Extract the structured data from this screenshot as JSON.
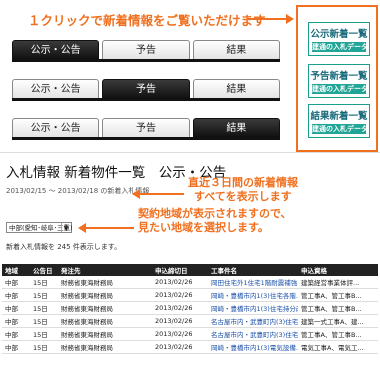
{
  "annotations": {
    "top": "１クリックで新着情報をご覧いただけます",
    "middle": [
      "直近３日間の新着情報",
      "すべてを表示します"
    ],
    "bottom": [
      "契約地域が表示されますので、",
      "見たい地域を選択します。"
    ]
  },
  "tab_rows": [
    {
      "tabs": [
        "公示・公告",
        "予告",
        "結果"
      ],
      "active": 0
    },
    {
      "tabs": [
        "公示・公告",
        "予告",
        "結果"
      ],
      "active": 1
    },
    {
      "tabs": [
        "公示・公告",
        "予告",
        "結果"
      ],
      "active": 2
    }
  ],
  "badges": [
    {
      "title": "公示新着一覧",
      "subtitle": "建通の入札データ"
    },
    {
      "title": "予告新着一覧",
      "subtitle": "建通の入札データ"
    },
    {
      "title": "結果新着一覧",
      "subtitle": "建通の入札データ"
    }
  ],
  "page": {
    "title": "入札情報 新着物件一覧　公示・公告",
    "date_range": "2013/02/15 ～ 2013/02/18 の新着入札情報",
    "region_select": "中部(愛知･岐阜･三重)",
    "count_text": "新着入札情報を 245 件表示します。"
  },
  "table": {
    "headers": [
      "地域",
      "公告日",
      "発注先",
      "申込締切日",
      "工事件名",
      "申込資格"
    ],
    "rows": [
      [
        "中部",
        "15日",
        "財務省東海財務局",
        "2013/02/26",
        "岡田住宅外1住宅1階耐震補強...",
        "建築経営事業体評..."
      ],
      [
        "中部",
        "15日",
        "財務省東海財務局",
        "2013/02/26",
        "岡崎・豊橋市内1(3)住宅各階...",
        "管工事A、管工事B..."
      ],
      [
        "中部",
        "15日",
        "財務省東海財務局",
        "2013/02/26",
        "岡崎・豊橋市内1(3)住宅持分改...",
        "管工事A、管工事B..."
      ],
      [
        "中部",
        "15日",
        "財務省東海財務局",
        "2013/02/26",
        "名古屋市内・武豊町内(3)住宅...",
        "建築一式工事A、建..."
      ],
      [
        "中部",
        "15日",
        "財務省東海財務局",
        "2013/02/26",
        "名古屋市内・武豊町内(3)住宅...",
        "管工事A、管工事B..."
      ],
      [
        "中部",
        "15日",
        "財務省東海財務局",
        "2013/02/26",
        "岡崎・豊橋市内1(3)電気設備...",
        "電気工事A、電気工..."
      ]
    ]
  }
}
